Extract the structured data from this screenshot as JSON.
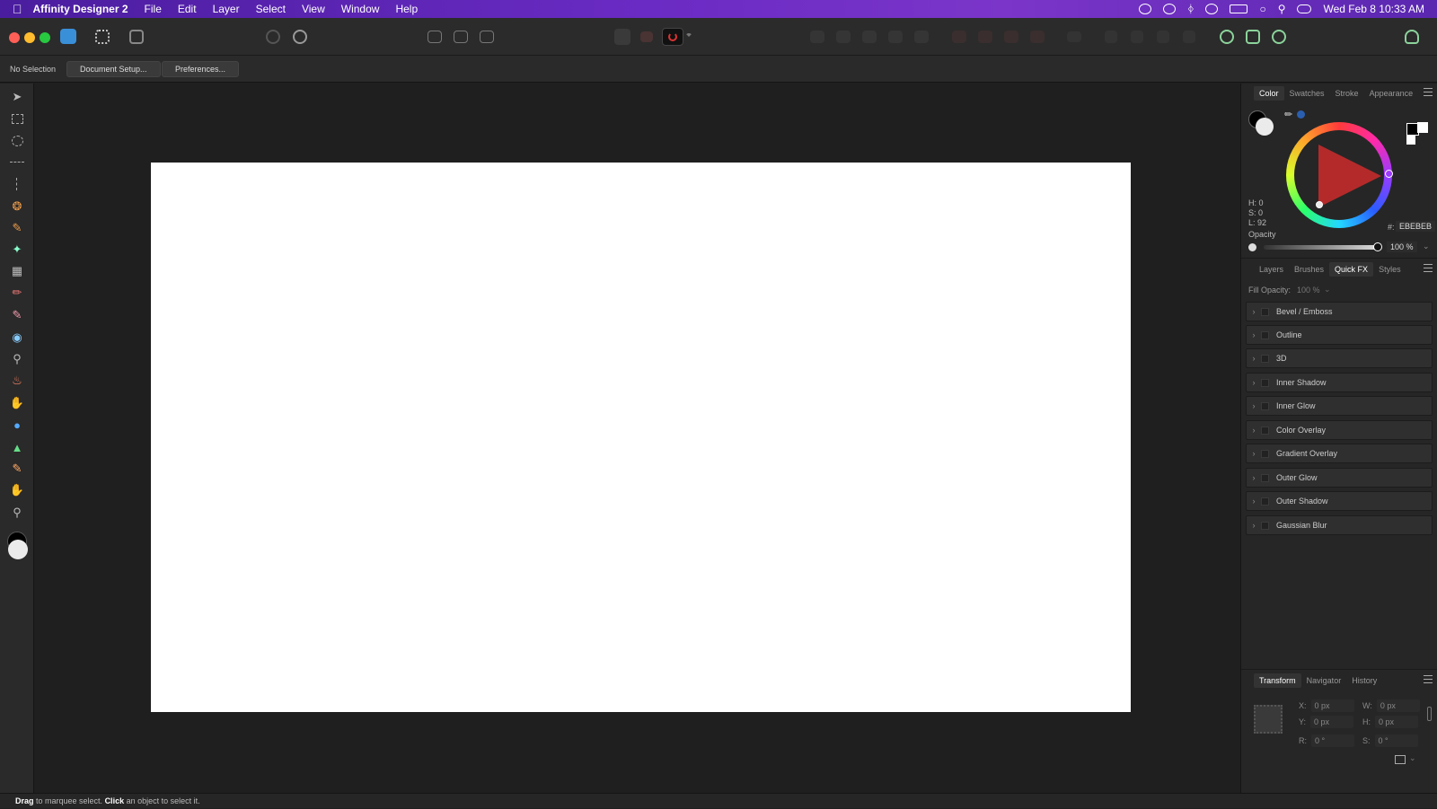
{
  "menubar": {
    "app_name": "Affinity Designer 2",
    "menus": [
      "File",
      "Edit",
      "Layer",
      "Select",
      "View",
      "Window",
      "Help"
    ],
    "clock": "Wed Feb 8  10:33 AM"
  },
  "context": {
    "selection_status": "No Selection",
    "document_setup": "Document Setup...",
    "preferences": "Preferences..."
  },
  "color_panel": {
    "tabs": [
      "Color",
      "Swatches",
      "Stroke",
      "Appearance"
    ],
    "active_tab": "Color",
    "h": "H: 0",
    "s": "S: 0",
    "l": "L: 92",
    "hex_label": "#:",
    "hex_value": "EBEBEB",
    "opacity_label": "Opacity",
    "opacity_value": "100 %"
  },
  "fx_panel": {
    "tabs": [
      "Layers",
      "Brushes",
      "Quick FX",
      "Styles"
    ],
    "active_tab": "Quick FX",
    "fill_opacity_label": "Fill Opacity:",
    "fill_opacity_value": "100 %",
    "effects": [
      "Bevel / Emboss",
      "Outline",
      "3D",
      "Inner Shadow",
      "Inner Glow",
      "Color Overlay",
      "Gradient Overlay",
      "Outer Glow",
      "Outer Shadow",
      "Gaussian Blur"
    ]
  },
  "transform_panel": {
    "tabs": [
      "Transform",
      "Navigator",
      "History"
    ],
    "active_tab": "Transform",
    "x_label": "X:",
    "x": "0 px",
    "y_label": "Y:",
    "y": "0 px",
    "w_label": "W:",
    "w": "0 px",
    "h_label": "H:",
    "h": "0 px",
    "r_label": "R:",
    "r": "0 °",
    "s_label": "S:",
    "s": "0 °"
  },
  "status": {
    "drag": "Drag",
    "drag_text": " to marquee select. ",
    "click": "Click",
    "click_text": " an object to select it."
  },
  "colors": {
    "accent": "#6a2bc4",
    "fill_primary": "#000000",
    "fill_secondary": "#ebebeb"
  }
}
